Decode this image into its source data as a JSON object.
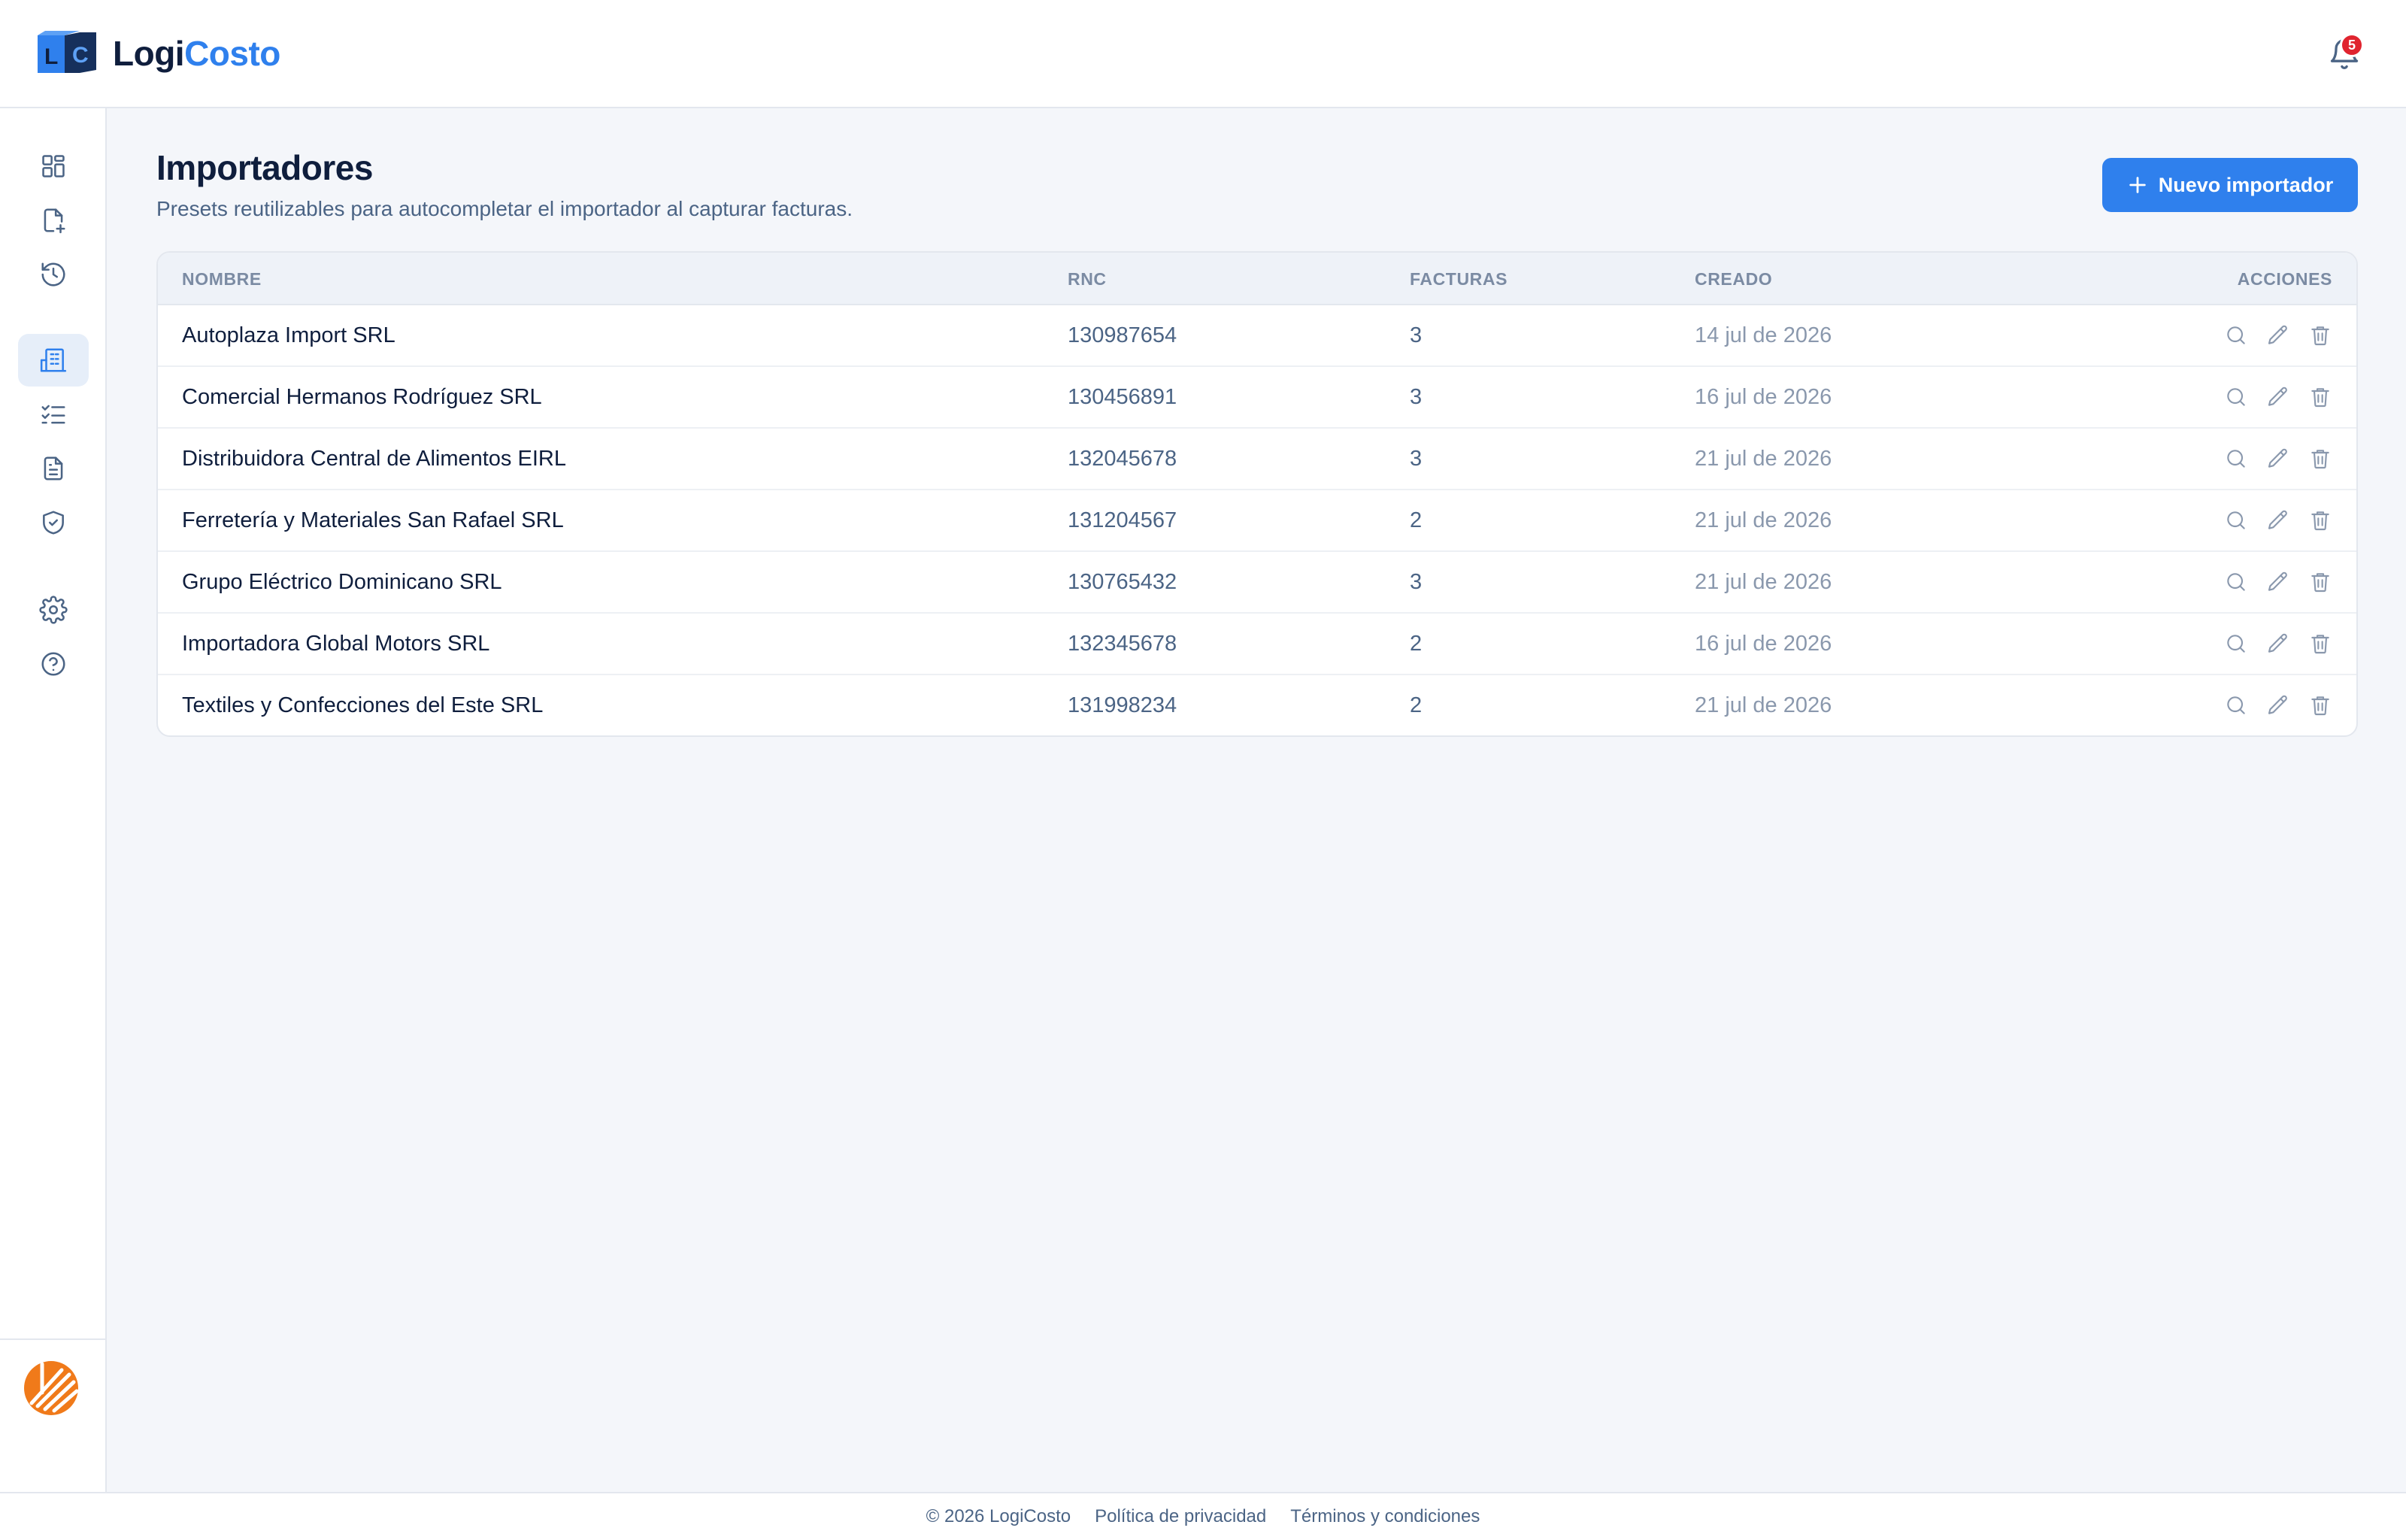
{
  "app": {
    "brand_part1": "Logi",
    "brand_part2": "Costo",
    "logo_letters": [
      "L",
      "C"
    ],
    "notifications_count": "5"
  },
  "sidebar": {
    "items": [
      {
        "icon": "dashboard-icon"
      },
      {
        "icon": "file-plus-icon"
      },
      {
        "icon": "history-icon"
      },
      {
        "icon": "building-icon",
        "active": true
      },
      {
        "icon": "checklist-icon"
      },
      {
        "icon": "document-icon"
      },
      {
        "icon": "shield-check-icon"
      },
      {
        "icon": "gear-icon"
      },
      {
        "icon": "help-icon"
      }
    ]
  },
  "page": {
    "title": "Importadores",
    "subtitle": "Presets reutilizables para autocompletar el importador al capturar facturas.",
    "new_button": "Nuevo importador"
  },
  "table": {
    "columns": [
      "NOMBRE",
      "RNC",
      "FACTURAS",
      "CREADO",
      "ACCIONES"
    ],
    "rows": [
      {
        "name": "Autoplaza Import SRL",
        "rnc": "130987654",
        "facturas": "3",
        "creado": "14 jul de 2026"
      },
      {
        "name": "Comercial Hermanos Rodríguez SRL",
        "rnc": "130456891",
        "facturas": "3",
        "creado": "16 jul de 2026"
      },
      {
        "name": "Distribuidora Central de Alimentos EIRL",
        "rnc": "132045678",
        "facturas": "3",
        "creado": "21 jul de 2026"
      },
      {
        "name": "Ferretería y Materiales San Rafael SRL",
        "rnc": "131204567",
        "facturas": "2",
        "creado": "21 jul de 2026"
      },
      {
        "name": "Grupo Eléctrico Dominicano SRL",
        "rnc": "130765432",
        "facturas": "3",
        "creado": "21 jul de 2026"
      },
      {
        "name": "Importadora Global Motors SRL",
        "rnc": "132345678",
        "facturas": "2",
        "creado": "16 jul de 2026"
      },
      {
        "name": "Textiles y Confecciones del Este SRL",
        "rnc": "131998234",
        "facturas": "2",
        "creado": "21 jul de 2026"
      }
    ]
  },
  "footer": {
    "copyright": "© 2026 LogiCosto",
    "privacy": "Política de privacidad",
    "terms": "Términos y condiciones"
  },
  "colors": {
    "accent": "#2f80ed",
    "badge": "#e0242f",
    "text_dark": "#0f1e3d",
    "text_muted": "#4b6485"
  }
}
